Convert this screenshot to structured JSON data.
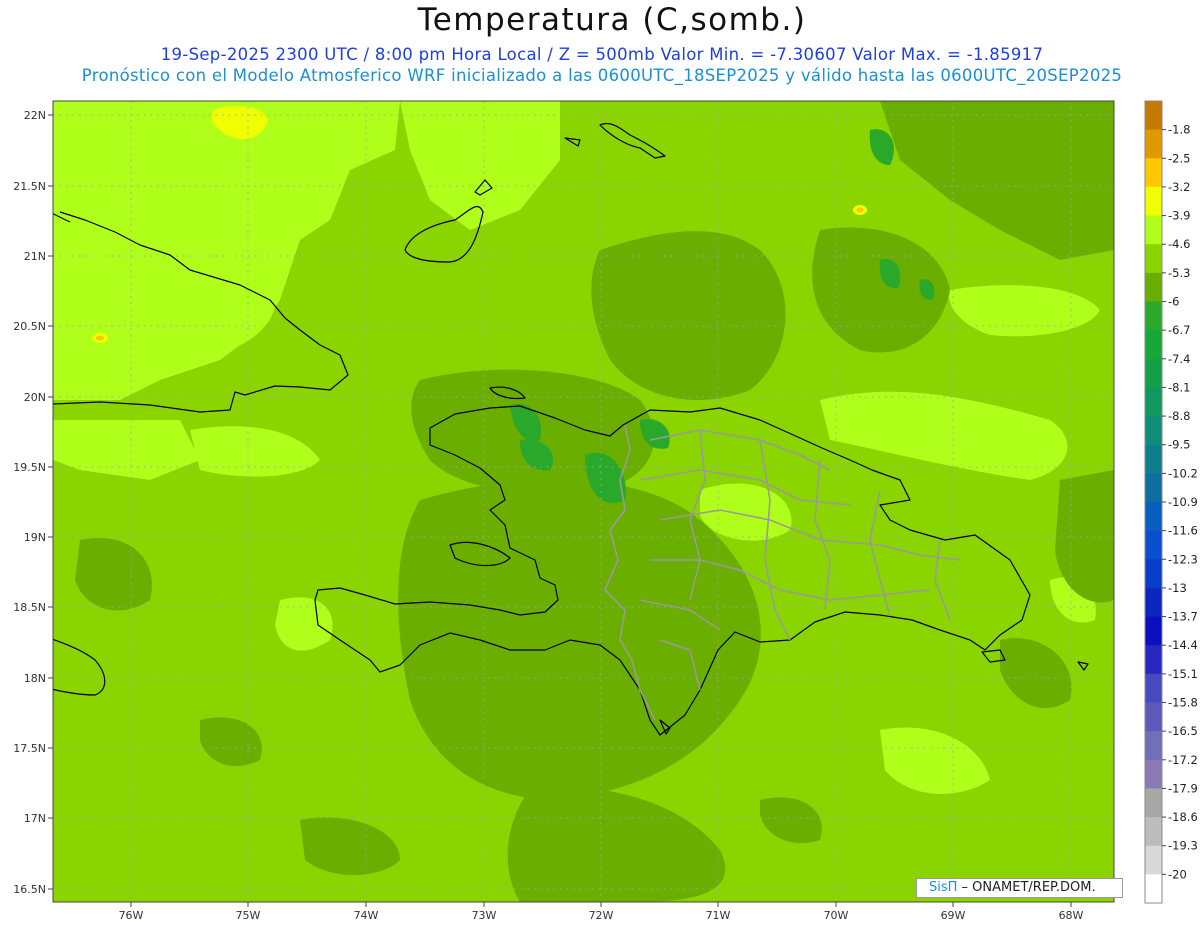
{
  "header": {
    "title": "Temperatura (C,somb.)",
    "line1": "19-Sep-2025  2300 UTC / 8:00 pm Hora Local / Z = 500mb  Valor Min. = -7.30607  Valor Max. = -1.85917",
    "line2": "Pronóstico con el Modelo Atmosferico WRF inicializado a las 0600UTC_18SEP2025 y válido hasta las  0600UTC_20SEP2025"
  },
  "map": {
    "lat_labels": [
      "22N",
      "21.5N",
      "21N",
      "20.5N",
      "20N",
      "19.5N",
      "19N",
      "18.5N",
      "18N",
      "17.5N",
      "17N",
      "16.5N"
    ],
    "lon_labels": [
      "76W",
      "75W",
      "74W",
      "73W",
      "72W",
      "71W",
      "70W",
      "69W",
      "68W"
    ],
    "background_color": "#8ad400"
  },
  "colorbar": {
    "labels": [
      "-1.8",
      "-2.5",
      "-3.2",
      "-3.9",
      "-4.6",
      "-5.3",
      "-6",
      "-6.7",
      "-7.4",
      "-8.1",
      "-8.8",
      "-9.5",
      "-10.2",
      "-10.9",
      "-11.6",
      "-12.3",
      "-13",
      "-13.7",
      "-14.4",
      "-15.1",
      "-15.8",
      "-16.5",
      "-17.2",
      "-17.9",
      "-18.6",
      "-19.3",
      "-20"
    ],
    "colors": [
      "#c47a00",
      "#e09a00",
      "#ffc800",
      "#f0ff00",
      "#b0ff1a",
      "#8ad400",
      "#6aae00",
      "#2aa82a",
      "#18a83a",
      "#12a048",
      "#0f9860",
      "#0e8e78",
      "#0e7e8e",
      "#0e6ea0",
      "#0a5ec0",
      "#0a4ed0",
      "#0a3ec8",
      "#0a28c0",
      "#0a10c0",
      "#2828c0",
      "#4848c0",
      "#5a5ab8",
      "#7070b8",
      "#8a7ab4",
      "#a8a8a8",
      "#bcbcbc",
      "#d8d8d8",
      "#ffffff"
    ]
  },
  "credit": {
    "logo": "SisΠ",
    "text": " – ONAMET/REP.DOM."
  }
}
